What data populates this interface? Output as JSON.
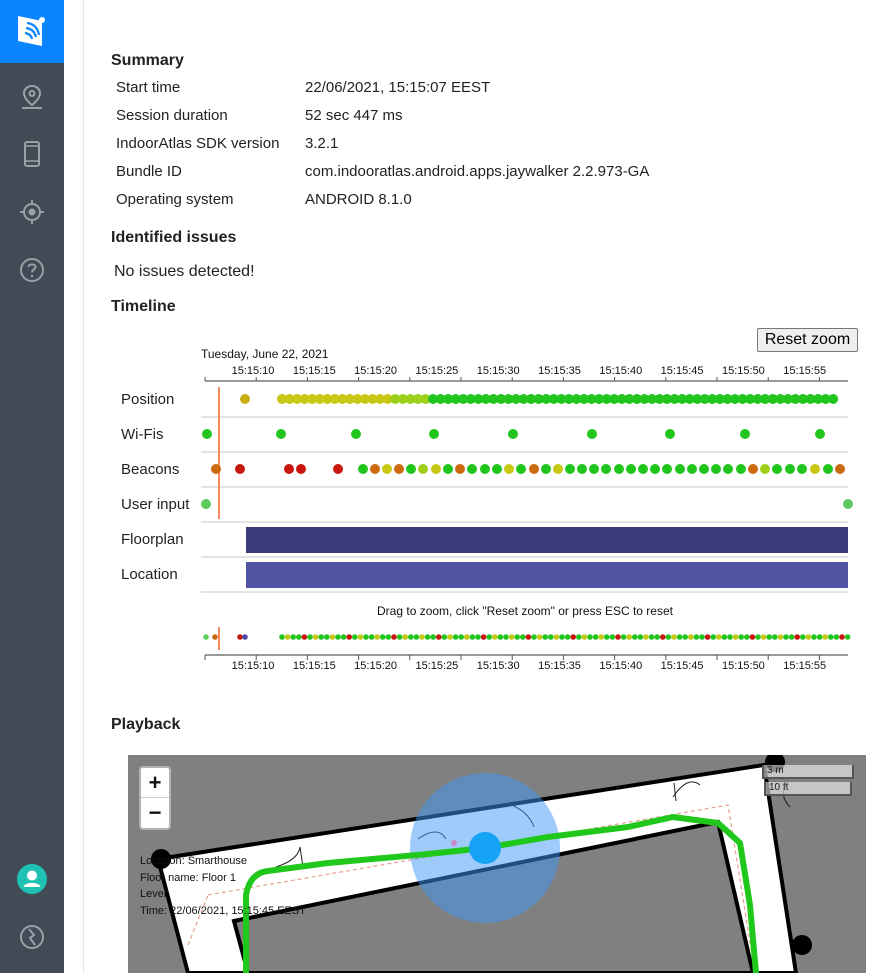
{
  "summary": {
    "title": "Summary",
    "rows": [
      {
        "key": "Start time",
        "value": "22/06/2021, 15:15:07 EEST"
      },
      {
        "key": "Session duration",
        "value": "52 sec 447 ms"
      },
      {
        "key": "IndoorAtlas SDK version",
        "value": "3.2.1"
      },
      {
        "key": "Bundle ID",
        "value": "com.indooratlas.android.apps.jaywalker 2.2.973-GA"
      },
      {
        "key": "Operating system",
        "value": "ANDROID 8.1.0"
      }
    ]
  },
  "issues": {
    "title": "Identified issues",
    "text": "No issues detected!"
  },
  "timeline": {
    "title": "Timeline",
    "reset_label": "Reset zoom",
    "date_label": "Tuesday, June 22, 2021",
    "ticks": [
      "15:15:10",
      "15:15:15",
      "15:15:20",
      "15:15:25",
      "15:15:30",
      "15:15:35",
      "15:15:40",
      "15:15:45",
      "15:15:50",
      "15:15:55"
    ],
    "rows": [
      "Position",
      "Wi-Fis",
      "Beacons",
      "User input",
      "Floorplan",
      "Location"
    ],
    "hint": "Drag to zoom, click \"Reset zoom\" or press ESC to reset",
    "colors": {
      "good": "#22c51e",
      "mid": "#c8c814",
      "low": "#cc6a10",
      "bad": "#c8170e",
      "floorplan": "#3a3b78",
      "location": "#5153a3",
      "marker": "#f58a5f"
    }
  },
  "playback": {
    "title": "Playback",
    "zoom_in": "+",
    "zoom_out": "−",
    "info": [
      "Location: Smarthouse",
      "Floor name: Floor 1",
      "Level:",
      "Time: 22/06/2021, 15:15:45 EEST"
    ],
    "scale_m": "3 m",
    "scale_ft": "10 ft"
  },
  "nav": {
    "logo": "indooratlas-logo-icon",
    "items": [
      "map-pin-icon",
      "phone-icon",
      "crosshair-icon",
      "help-icon"
    ],
    "bottom": [
      "user-icon",
      "power-icon"
    ]
  }
}
